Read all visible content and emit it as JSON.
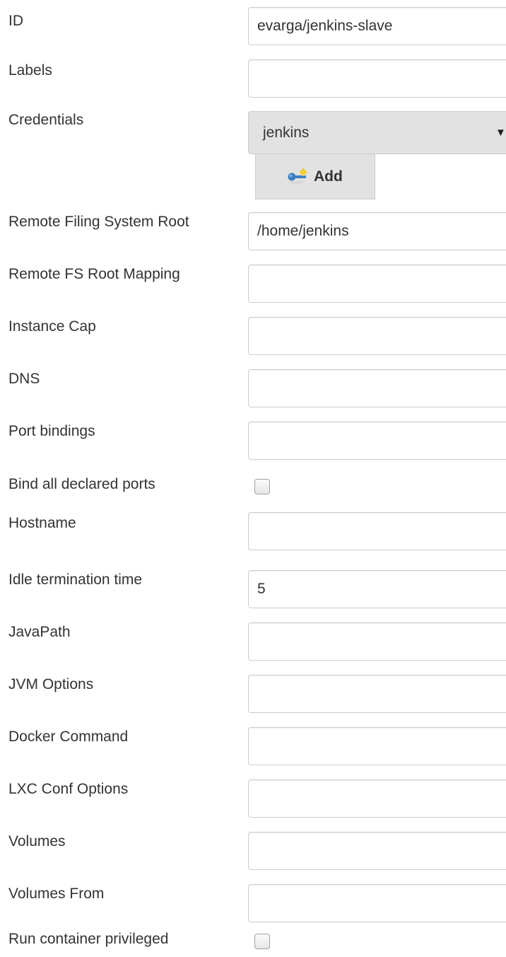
{
  "fields": {
    "id": {
      "label": "ID",
      "value": "evarga/jenkins-slave"
    },
    "labels": {
      "label": "Labels",
      "value": ""
    },
    "credentials": {
      "label": "Credentials",
      "selected": "jenkins",
      "add_label": "Add"
    },
    "remote_fs_root": {
      "label": "Remote Filing System Root",
      "value": "/home/jenkins"
    },
    "remote_fs_root_mapping": {
      "label": "Remote FS Root Mapping",
      "value": ""
    },
    "instance_cap": {
      "label": "Instance Cap",
      "value": ""
    },
    "dns": {
      "label": "DNS",
      "value": ""
    },
    "port_bindings": {
      "label": "Port bindings",
      "value": ""
    },
    "bind_all_ports": {
      "label": "Bind all declared ports",
      "checked": false
    },
    "hostname": {
      "label": "Hostname",
      "value": ""
    },
    "idle_termination_time": {
      "label": "Idle termination time",
      "value": "5"
    },
    "java_path": {
      "label": "JavaPath",
      "value": ""
    },
    "jvm_options": {
      "label": "JVM Options",
      "value": ""
    },
    "docker_command": {
      "label": "Docker Command",
      "value": ""
    },
    "lxc_conf_options": {
      "label": "LXC Conf Options",
      "value": ""
    },
    "volumes": {
      "label": "Volumes",
      "value": ""
    },
    "volumes_from": {
      "label": "Volumes From",
      "value": ""
    },
    "run_privileged": {
      "label": "Run container privileged",
      "checked": false
    }
  },
  "icons": {
    "dropdown_arrow": "triangle-down",
    "add_credential": "key-icon"
  }
}
